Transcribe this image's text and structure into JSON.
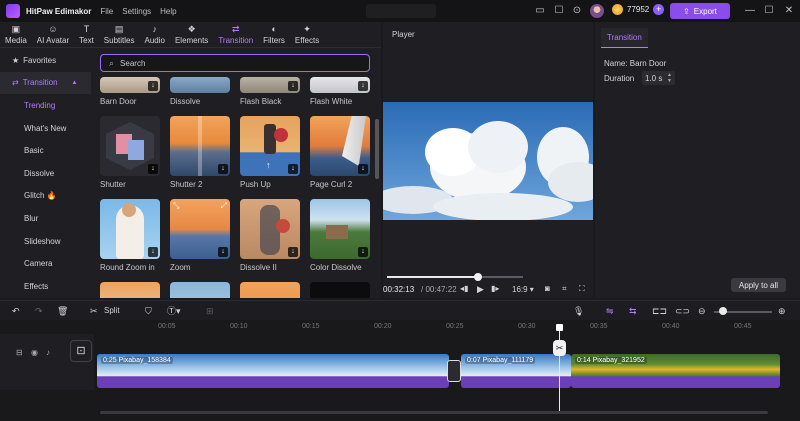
{
  "app": {
    "name": "HitPaw Edimakor"
  },
  "menu": [
    "File",
    "Settings",
    "Help"
  ],
  "account": {
    "coins": "77952"
  },
  "export_label": "Export",
  "media_tabs": [
    {
      "label": "Media",
      "icon": "▣"
    },
    {
      "label": "AI Avatar",
      "icon": "☺"
    },
    {
      "label": "Text",
      "icon": "T"
    },
    {
      "label": "Subtitles",
      "icon": "▤"
    },
    {
      "label": "Audio",
      "icon": "♪"
    },
    {
      "label": "Elements",
      "icon": "❖"
    },
    {
      "label": "Transition",
      "icon": "⇄"
    },
    {
      "label": "Filters",
      "icon": "◐"
    },
    {
      "label": "Effects",
      "icon": "✦"
    }
  ],
  "sidebar": {
    "favorites": "Favorites",
    "section": "Transition",
    "items": [
      "Trending",
      "What's New",
      "Basic",
      "Dissolve",
      "Glitch 🔥",
      "Blur",
      "Slideshow",
      "Camera",
      "Effects"
    ]
  },
  "search": {
    "placeholder": "Search"
  },
  "transitions": {
    "row0": [
      "Barn Door",
      "Dissolve",
      "Flash Black",
      "Flash White"
    ],
    "row1": [
      "Shutter",
      "Shutter 2",
      "Push Up",
      "Page Curl 2"
    ],
    "row2": [
      "Round Zoom in",
      "Zoom",
      "Dissolve II",
      "Color Dissolve"
    ]
  },
  "player": {
    "title": "Player",
    "current_time": "00:32:13",
    "total_time": "/ 00:47:22",
    "ratio": "16:9",
    "progress": 0.67
  },
  "properties": {
    "tab": "Transition",
    "name": "Name: Barn Door",
    "duration_label": "Duration",
    "duration_value": "1.0 s",
    "apply_all": "Apply to all"
  },
  "timeline": {
    "split_label": "Split",
    "ruler": [
      "00:05",
      "00:10",
      "00:15",
      "00:20",
      "00:25",
      "00:30",
      "00:35",
      "00:40",
      "00:45"
    ],
    "clips": [
      {
        "name": "0:25 Pixabay_158384"
      },
      {
        "name": "0:07 Pixabay_111179"
      },
      {
        "name": "0:14 Pixabay_321952"
      }
    ]
  },
  "colors": {
    "accent": "#8a4dea",
    "accent_text": "#b27cff",
    "clip_strip": "#6a3fb8"
  }
}
